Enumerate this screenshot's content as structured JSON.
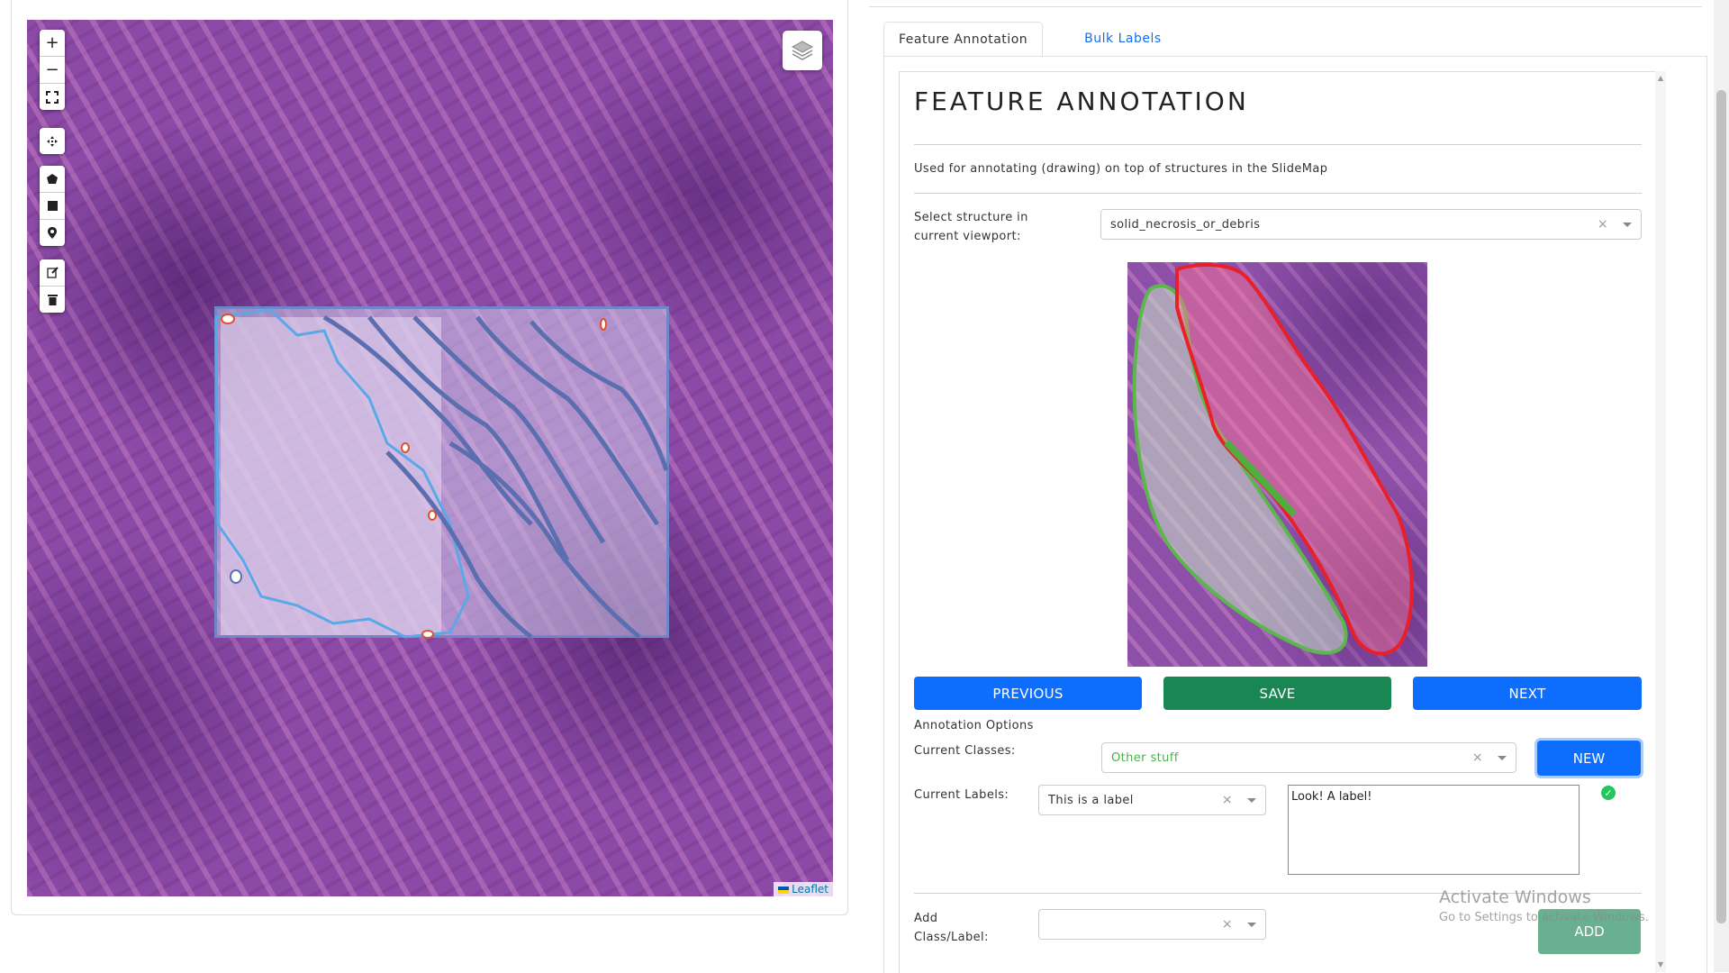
{
  "map": {
    "zoom_in": "+",
    "zoom_out": "−",
    "attribution": "Leaflet"
  },
  "tabs": [
    {
      "label": "Feature Annotation",
      "active": true
    },
    {
      "label": "Bulk Labels",
      "active": false
    }
  ],
  "panel": {
    "title": "FEATURE ANNOTATION",
    "description": "Used for annotating (drawing) on top of structures in the SlideMap",
    "structure_label_line1": "Select structure in",
    "structure_label_line2": "current viewport:",
    "structure_value": "solid_necrosis_or_debris"
  },
  "buttons": {
    "previous": "PREVIOUS",
    "save": "SAVE",
    "next": "NEXT",
    "new": "NEW",
    "add": "ADD"
  },
  "options": {
    "heading": "Annotation Options",
    "classes_label": "Current Classes:",
    "classes_value": "Other stuff",
    "labels_label": "Current Labels:",
    "labels_value": "This is a label",
    "label_text": "Look! A label!",
    "add_label_line1": "Add",
    "add_label_line2": "Class/Label:",
    "add_value": ""
  },
  "watermark": {
    "line1": "Activate Windows",
    "line2": "Go to Settings to activate Windows."
  },
  "colors": {
    "primary": "#0d6efd",
    "success": "#198754",
    "class_text": "#4caf50",
    "annotation_red": "#e8202a",
    "annotation_green": "#5ab84a",
    "outline_blue": "#5aa8e8"
  }
}
